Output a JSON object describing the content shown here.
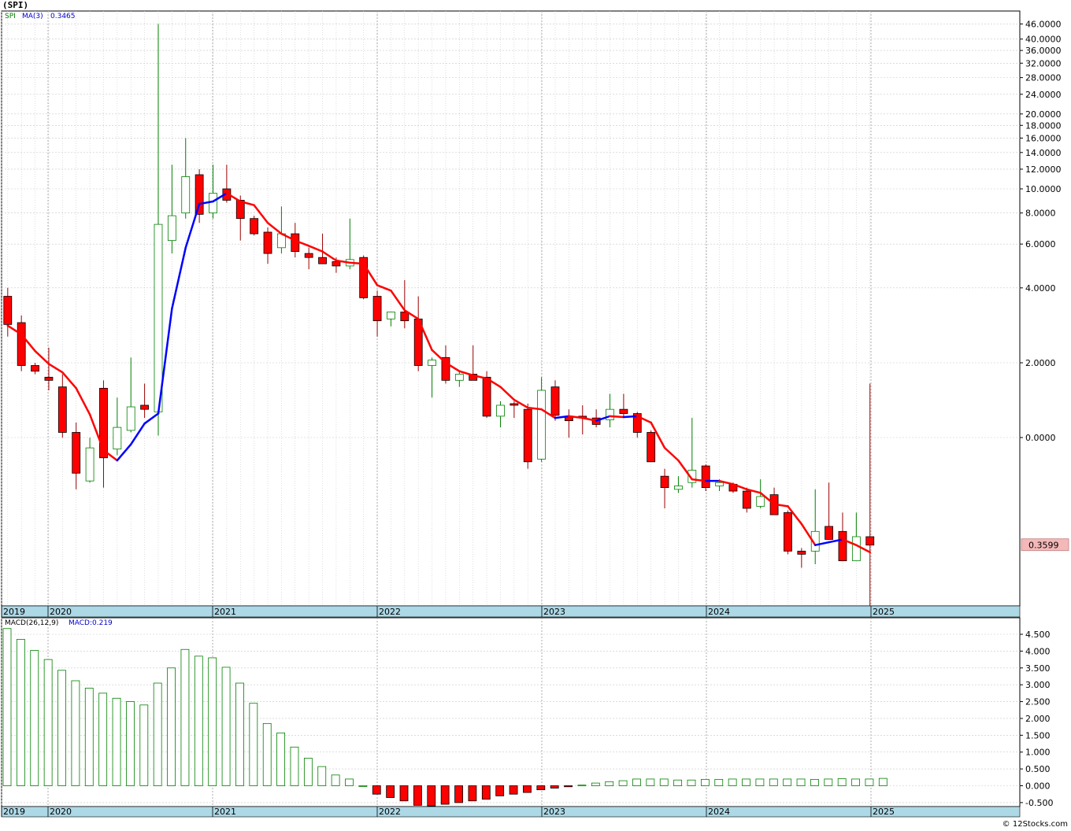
{
  "title": "(SPI)",
  "footer": "© 12Stocks.com",
  "colors": {
    "up": "#008000",
    "down": "#ff0000",
    "ma_up": "#0000ff",
    "ma_down": "#ff0000",
    "xbar": "#add8e6",
    "grid": "#c8c8c8",
    "last_price_bg": "#f5b8b8"
  },
  "chart_data": [
    {
      "type": "candlestick",
      "panel": "price",
      "legend": {
        "symbol": "SPI",
        "ma_label": "MA(3)",
        "ma_value": "0.3465"
      },
      "last_price": "0.3599",
      "y_scale": "log",
      "y_ticks": [
        "46.0000",
        "40.0000",
        "36.0000",
        "32.0000",
        "28.0000",
        "24.0000",
        "20.0000",
        "18.0000",
        "16.0000",
        "14.0000",
        "12.0000",
        "10.0000",
        "8.0000",
        "6.0000",
        "4.0000",
        "2.0000",
        "0.0000"
      ],
      "x_labels": [
        "2019",
        "2020",
        "2021",
        "2022",
        "2023",
        "2024",
        "2025"
      ],
      "candles": [
        {
          "o": 3.7,
          "h": 4.0,
          "l": 2.55,
          "c": 2.85
        },
        {
          "o": 2.9,
          "h": 3.1,
          "l": 1.85,
          "c": 1.95
        },
        {
          "o": 1.95,
          "h": 2.0,
          "l": 1.8,
          "c": 1.85
        },
        {
          "o": 1.75,
          "h": 2.3,
          "l": 1.55,
          "c": 1.7
        },
        {
          "o": 1.6,
          "h": 1.8,
          "l": 1.0,
          "c": 1.05
        },
        {
          "o": 1.05,
          "h": 1.15,
          "l": 0.62,
          "c": 0.72
        },
        {
          "o": 0.67,
          "h": 1.0,
          "l": 0.66,
          "c": 0.91
        },
        {
          "o": 1.58,
          "h": 1.7,
          "l": 0.63,
          "c": 0.83
        },
        {
          "o": 0.9,
          "h": 1.45,
          "l": 0.85,
          "c": 1.1
        },
        {
          "o": 1.07,
          "h": 2.1,
          "l": 1.05,
          "c": 1.33
        },
        {
          "o": 1.35,
          "h": 1.65,
          "l": 1.2,
          "c": 1.3
        },
        {
          "o": 1.27,
          "h": 46.0,
          "l": 1.02,
          "c": 7.2
        },
        {
          "o": 6.2,
          "h": 12.5,
          "l": 5.5,
          "c": 7.8
        },
        {
          "o": 8.0,
          "h": 16.0,
          "l": 7.6,
          "c": 11.2
        },
        {
          "o": 11.4,
          "h": 12.0,
          "l": 7.3,
          "c": 7.9
        },
        {
          "o": 8.0,
          "h": 12.5,
          "l": 7.6,
          "c": 9.6
        },
        {
          "o": 10.0,
          "h": 12.5,
          "l": 8.8,
          "c": 9.0
        },
        {
          "o": 9.0,
          "h": 9.4,
          "l": 6.2,
          "c": 7.6
        },
        {
          "o": 7.6,
          "h": 7.8,
          "l": 6.5,
          "c": 6.6
        },
        {
          "o": 6.7,
          "h": 7.0,
          "l": 5.0,
          "c": 5.5
        },
        {
          "o": 5.8,
          "h": 8.5,
          "l": 5.5,
          "c": 6.6
        },
        {
          "o": 6.6,
          "h": 7.3,
          "l": 5.3,
          "c": 5.6
        },
        {
          "o": 5.5,
          "h": 5.8,
          "l": 4.75,
          "c": 5.3
        },
        {
          "o": 5.3,
          "h": 6.6,
          "l": 5.0,
          "c": 5.0
        },
        {
          "o": 5.1,
          "h": 5.3,
          "l": 4.6,
          "c": 4.9
        },
        {
          "o": 4.9,
          "h": 7.6,
          "l": 4.75,
          "c": 5.2
        },
        {
          "o": 5.3,
          "h": 5.4,
          "l": 3.6,
          "c": 3.65
        },
        {
          "o": 3.7,
          "h": 3.9,
          "l": 2.55,
          "c": 2.95
        },
        {
          "o": 3.0,
          "h": 3.2,
          "l": 2.8,
          "c": 3.2
        },
        {
          "o": 3.2,
          "h": 4.3,
          "l": 2.75,
          "c": 2.95
        },
        {
          "o": 3.0,
          "h": 3.7,
          "l": 1.85,
          "c": 1.95
        },
        {
          "o": 1.95,
          "h": 2.1,
          "l": 1.45,
          "c": 2.05
        },
        {
          "o": 2.1,
          "h": 2.35,
          "l": 1.65,
          "c": 1.7
        },
        {
          "o": 1.7,
          "h": 1.85,
          "l": 1.6,
          "c": 1.8
        },
        {
          "o": 1.8,
          "h": 2.35,
          "l": 1.7,
          "c": 1.7
        },
        {
          "o": 1.75,
          "h": 1.85,
          "l": 1.2,
          "c": 1.22
        },
        {
          "o": 1.22,
          "h": 1.4,
          "l": 1.1,
          "c": 1.35
        },
        {
          "o": 1.37,
          "h": 1.4,
          "l": 1.2,
          "c": 1.35
        },
        {
          "o": 1.3,
          "h": 1.37,
          "l": 0.75,
          "c": 0.8
        },
        {
          "o": 0.82,
          "h": 1.75,
          "l": 0.8,
          "c": 1.55
        },
        {
          "o": 1.6,
          "h": 1.7,
          "l": 1.17,
          "c": 1.23
        },
        {
          "o": 1.22,
          "h": 1.3,
          "l": 1.0,
          "c": 1.17
        },
        {
          "o": 1.22,
          "h": 1.35,
          "l": 1.03,
          "c": 1.2
        },
        {
          "o": 1.2,
          "h": 1.3,
          "l": 1.1,
          "c": 1.13
        },
        {
          "o": 1.18,
          "h": 1.5,
          "l": 1.1,
          "c": 1.3
        },
        {
          "o": 1.3,
          "h": 1.5,
          "l": 1.2,
          "c": 1.25
        },
        {
          "o": 1.25,
          "h": 1.27,
          "l": 1.0,
          "c": 1.05
        },
        {
          "o": 1.05,
          "h": 1.07,
          "l": 0.8,
          "c": 0.8
        },
        {
          "o": 0.7,
          "h": 0.75,
          "l": 0.52,
          "c": 0.63
        },
        {
          "o": 0.62,
          "h": 0.7,
          "l": 0.6,
          "c": 0.64
        },
        {
          "o": 0.66,
          "h": 1.2,
          "l": 0.63,
          "c": 0.74
        },
        {
          "o": 0.77,
          "h": 0.78,
          "l": 0.61,
          "c": 0.63
        },
        {
          "o": 0.64,
          "h": 0.68,
          "l": 0.61,
          "c": 0.66
        },
        {
          "o": 0.65,
          "h": 0.66,
          "l": 0.6,
          "c": 0.61
        },
        {
          "o": 0.61,
          "h": 0.63,
          "l": 0.5,
          "c": 0.52
        },
        {
          "o": 0.53,
          "h": 0.68,
          "l": 0.52,
          "c": 0.58
        },
        {
          "o": 0.59,
          "h": 0.63,
          "l": 0.49,
          "c": 0.49
        },
        {
          "o": 0.5,
          "h": 0.51,
          "l": 0.34,
          "c": 0.35
        },
        {
          "o": 0.35,
          "h": 0.36,
          "l": 0.3,
          "c": 0.34
        },
        {
          "o": 0.35,
          "h": 0.62,
          "l": 0.31,
          "c": 0.42
        },
        {
          "o": 0.44,
          "h": 0.66,
          "l": 0.39,
          "c": 0.39
        },
        {
          "o": 0.42,
          "h": 0.5,
          "l": 0.32,
          "c": 0.32
        },
        {
          "o": 0.32,
          "h": 0.5,
          "l": 0.32,
          "c": 0.4
        },
        {
          "o": 0.4,
          "h": 1.65,
          "l": 0.2,
          "c": 0.37
        }
      ],
      "ma": [
        2.82,
        2.6,
        2.23,
        1.98,
        1.83,
        1.58,
        1.24,
        0.89,
        0.81,
        0.94,
        1.14,
        1.25,
        3.3,
        5.8,
        8.7,
        8.9,
        9.6,
        8.9,
        8.6,
        7.3,
        6.6,
        6.2,
        5.9,
        5.6,
        5.15,
        5.05,
        5.0,
        4.1,
        3.9,
        3.25,
        3.0,
        2.25,
        2.0,
        1.85,
        1.78,
        1.73,
        1.6,
        1.42,
        1.32,
        1.3,
        1.2,
        1.22,
        1.2,
        1.17,
        1.22,
        1.21,
        1.22,
        1.15,
        0.91,
        0.81,
        0.68,
        0.67,
        0.67,
        0.65,
        0.62,
        0.6,
        0.54,
        0.53,
        0.45,
        0.37,
        0.38,
        0.39,
        0.37,
        0.3465
      ]
    },
    {
      "type": "bar",
      "panel": "macd",
      "legend": {
        "name": "MACD(26,12,9)",
        "value_label": "MACD:0.219"
      },
      "y_ticks": [
        "4.500",
        "4.000",
        "3.500",
        "3.000",
        "2.500",
        "2.000",
        "1.500",
        "1.000",
        "0.500",
        "0.000",
        "-0.500"
      ],
      "ylim": [
        -0.6,
        4.75
      ],
      "values": [
        4.67,
        4.35,
        4.02,
        3.75,
        3.43,
        3.12,
        2.9,
        2.75,
        2.6,
        2.5,
        2.4,
        3.05,
        3.5,
        4.05,
        3.85,
        3.8,
        3.52,
        3.05,
        2.45,
        1.85,
        1.57,
        1.15,
        0.82,
        0.57,
        0.32,
        0.2,
        0.0,
        -0.25,
        -0.35,
        -0.45,
        -0.58,
        -0.6,
        -0.55,
        -0.5,
        -0.45,
        -0.4,
        -0.3,
        -0.25,
        -0.2,
        -0.12,
        -0.07,
        -0.03,
        0.02,
        0.08,
        0.12,
        0.15,
        0.2,
        0.2,
        0.2,
        0.17,
        0.17,
        0.19,
        0.19,
        0.2,
        0.2,
        0.2,
        0.2,
        0.2,
        0.2,
        0.19,
        0.2,
        0.21,
        0.2,
        0.2,
        0.219
      ]
    }
  ]
}
